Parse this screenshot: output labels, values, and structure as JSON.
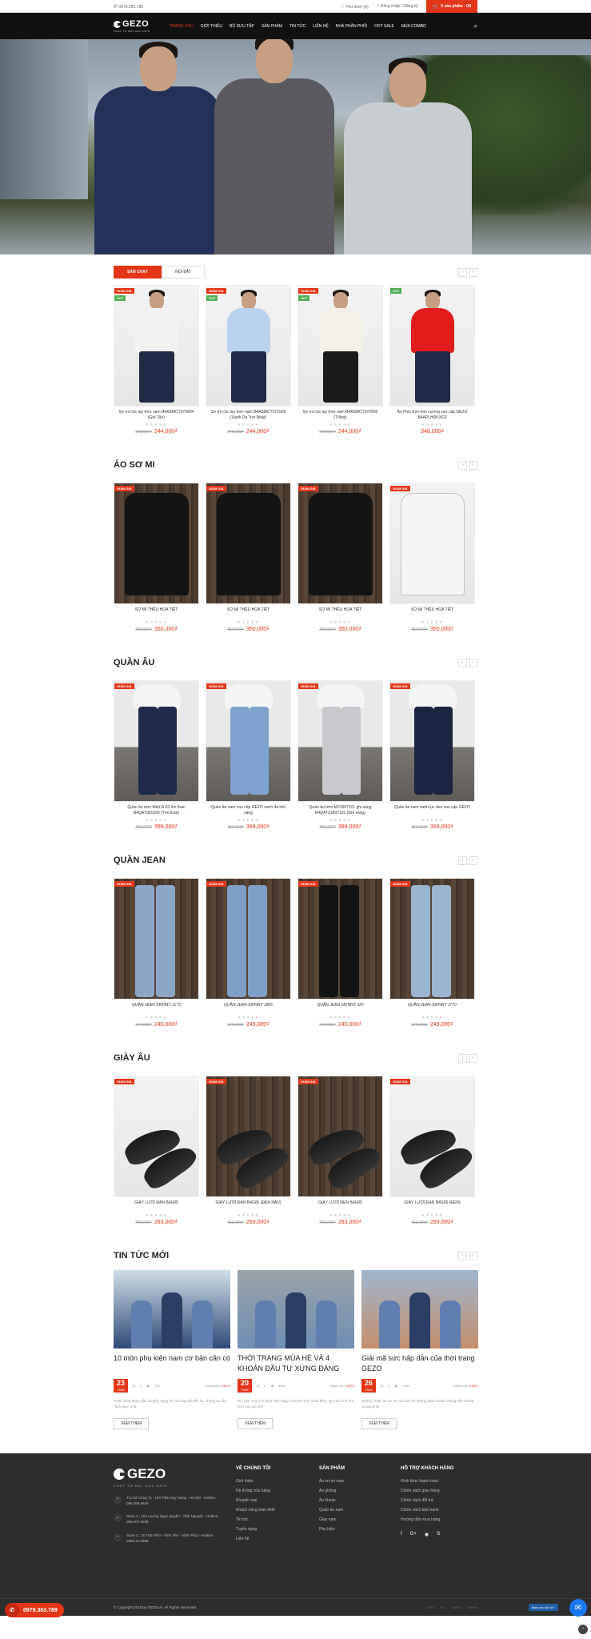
{
  "topbar": {
    "phone": "0979.383.789",
    "wishlist": "Yêu thích (0)",
    "account": "Đăng nhập / Đăng ký",
    "cart": "0 sản phẩm - 0đ"
  },
  "nav": {
    "logo": "GEZO",
    "tagline": "CHẤT TỪ MỌI GÓC NHÌN",
    "items": [
      "TRANG CHỦ",
      "GIỚI THIỆU",
      "BỘ SƯU TẬP",
      "SẢN PHẨM",
      "TIN TỨC",
      "LIÊN HỆ",
      "NHÀ PHÂN PHỐI",
      "HOT SALE",
      "MÙA COMBO"
    ]
  },
  "tabs": {
    "best": "SẢN CHẠY",
    "featured": "NỔI BẬT"
  },
  "sections": [
    {
      "title": "",
      "products": [
        {
          "name": "Sơ mi cộc tay trơn nam B4ASMCT973004 (Ghi Tẩn)",
          "old": "348,000₫",
          "price": "244,000₫",
          "badges": [
            "GIẢM GIÁ",
            "HOT"
          ]
        },
        {
          "name": "Sơ mi cộc tay trơn nam B4ASMCT971006 (Xanh Da Trời Nhạt)",
          "old": "348,000₫",
          "price": "244,000₫",
          "badges": [
            "GIẢM GIÁ",
            "HOT"
          ]
        },
        {
          "name": "Sơ mi cộc tay trơn nam B4ASMCT972002 (Trắng)",
          "old": "348,000₫",
          "price": "244,000₫",
          "badges": [
            "GIẢM GIÁ",
            "HOT"
          ]
        },
        {
          "name": "Áo Polo trơn kim cương cao cấp GEZO B4APLH08.002)",
          "old": "",
          "price": "348,000₫",
          "badges": [
            "HOT"
          ]
        }
      ]
    },
    {
      "title": "ÁO SƠ MI",
      "products": [
        {
          "name": "SƠ MI THÊU HỌA TIẾT",
          "old": "450,000₫",
          "price": "350,000₫",
          "badges": [
            "GIẢM GIÁ"
          ]
        },
        {
          "name": "SƠ MI THÊU HỌA TIẾT",
          "old": "450,000₫",
          "price": "350,000₫",
          "badges": [
            "GIẢM GIÁ"
          ]
        },
        {
          "name": "SƠ MI THÊU HỌA TIẾT",
          "old": "450,000₫",
          "price": "350,000₫",
          "badges": [
            "GIẢM GIÁ"
          ]
        },
        {
          "name": "SƠ MI THÊU HỌA TIẾT",
          "old": "450,000₫",
          "price": "350,000₫",
          "badges": [
            "GIẢM GIÁ"
          ]
        }
      ]
    },
    {
      "title": "QUẦN ÂU",
      "products": [
        {
          "name": "Quần âu trơn Melt là 03 tím than B4QAT991009 (Tím than)",
          "old": "450,000₫",
          "price": "399,000₫",
          "badges": [
            "GIẢM GIÁ"
          ]
        },
        {
          "name": "Quần âu nam cao cấp GEZO xanh da trời sáng",
          "old": "450,000₫",
          "price": "399,000₫",
          "badges": [
            "GIẢM GIÁ"
          ]
        },
        {
          "name": "Quần âu trơn M21897101 ghi sáng B4QAT21897101 (Ghi sáng)",
          "old": "450,000₫",
          "price": "399,000₫",
          "badges": [
            "GIẢM GIÁ"
          ]
        },
        {
          "name": "Quần âu nam xanh lục đen cao cấp GEZO",
          "old": "450,000₫",
          "price": "399,000₫",
          "badges": [
            "GIẢM GIÁ"
          ]
        }
      ]
    },
    {
      "title": "QUẦN JEAN",
      "products": [
        {
          "name": "QUẦN JEAN SKINNY J173",
          "old": "370,000₫",
          "price": "240,000₫",
          "badges": [
            "GIẢM GIÁ"
          ]
        },
        {
          "name": "QUẦN JEAN SKINNY J866",
          "old": "370,000₫",
          "price": "249,000₫",
          "badges": [
            "GIẢM GIÁ"
          ]
        },
        {
          "name": "QUẦN JEAN SKINNY J20",
          "old": "370,000₫",
          "price": "249,000₫",
          "badges": [
            "GIẢM GIÁ"
          ]
        },
        {
          "name": "QUẦN JEAN SKINNY J770",
          "old": "370,000₫",
          "price": "249,000₫",
          "badges": [
            "GIẢM GIÁ"
          ]
        }
      ]
    },
    {
      "title": "GIÀY ÂU",
      "products": [
        {
          "name": "GIÀY LƯỜI ĐAN B4G05",
          "old": "450,000₫",
          "price": "293,000₫",
          "badges": [
            "GIẢM GIÁ"
          ]
        },
        {
          "name": "GIÀY LƯỜI ĐAN B4G05 (ĐEN NÂU)",
          "old": "450,000₫",
          "price": "293,000₫",
          "badges": [
            "GIẢM GIÁ"
          ]
        },
        {
          "name": "GIÀY LƯỜI ĐEN B4G05",
          "old": "450,000₫",
          "price": "293,000₫",
          "badges": [
            "GIẢM GIÁ"
          ]
        },
        {
          "name": "GIÀY LƯỜI ĐAN B4G05 (ĐEN)",
          "old": "450,000₫",
          "price": "293,000₫",
          "badges": [
            "GIẢM GIÁ"
          ]
        }
      ]
    }
  ],
  "news": {
    "title": "TIN TỨC MỚI",
    "more": "XEM THÊM",
    "posts": [
      {
        "title": "10 món phụ kiện nam cơ bản cần có",
        "day": "23",
        "month": "Th08",
        "comments": "0",
        "views": "79c",
        "author_label": "Đăng bởi:",
        "author": "GEZO",
        "excerpt": "Xuân cũng đang dần chuyển sang hè và cũng đã đến lúc chúng ta cần \"dọn dẹp\" một"
      },
      {
        "title": "THỜI TRANG MÙA HÈ VÀ 4 KHOẢN ĐẦU TƯ XỨNG ĐÁNG",
        "day": "20",
        "month": "Th08",
        "comments": "0",
        "views": "898c",
        "author_label": "Đăng bởi:",
        "author": "GEZO",
        "excerpt": "Hội quý ông mới phát hiện ngày càng trở nên sành điệu, tạo nên sức hút hơn bao giờ hết"
      },
      {
        "title": "Giải mã sức hấp dẫn của thời trang GEZO",
        "day": "26",
        "month": "Th04",
        "comments": "0",
        "views": "444c",
        "author_label": "Đăng bởi:",
        "author": "GEZO",
        "excerpt": "Những chiếc áo sơ mi của bạn sẽ phồng phiu nhanh chóng nếu không có quyết là"
      }
    ]
  },
  "footer": {
    "logo": "GEZO",
    "tagline": "CHẤT TỪ MỌI GÓC NHÌN",
    "addresses": [
      "Trụ Sở Công Ty : 194 Trần Duy Hưng - Hà Nội - Hotline: 096.369.6939",
      "Store 1 : 104 Lương Ngọc Quyến - Thái Nguyên - Hotline: 096.307.8338",
      "Store 2 : 20 Trần Phú - Vĩnh Yên - Vĩnh Phúc - Hotline: 0969.31.0988"
    ],
    "about_title": "VỀ CHÚNG TÔI",
    "about": [
      "Giới thiệu",
      "Hệ thống cửa hàng",
      "Khuyến mại",
      "Khách hàng thân thiết",
      "Tin tức",
      "Tuyển dụng",
      "Liên hệ"
    ],
    "products_title": "SẢN PHẨM",
    "products": [
      "Áo sơ mi nam",
      "Áo phông",
      "Áo khoác",
      "Quần âu nam",
      "Giày nam",
      "Phụ kiện"
    ],
    "support_title": "HỖ TRỢ KHÁCH HÀNG",
    "support": [
      "Hình thức thanh toán",
      "Chính sách giao hàng",
      "Chính sách đổi trả",
      "Chính sách bảo hành",
      "Hướng dẫn mua hàng"
    ],
    "socials": [
      "f",
      "G+",
      "◉",
      "S"
    ],
    "copyright": "© Copyright 2018 by GEZO.vn. All Rights Reserved",
    "payments": [
      "VISA",
      "MC",
      "AMEX",
      "PayPal"
    ]
  },
  "widgets": {
    "hotline": "0979.383.789",
    "chat_label": "Bạn cần hỗ trợ?"
  },
  "colors": {
    "accent": "#e53517",
    "nav": "#111111",
    "footer": "#2d2d2d"
  }
}
